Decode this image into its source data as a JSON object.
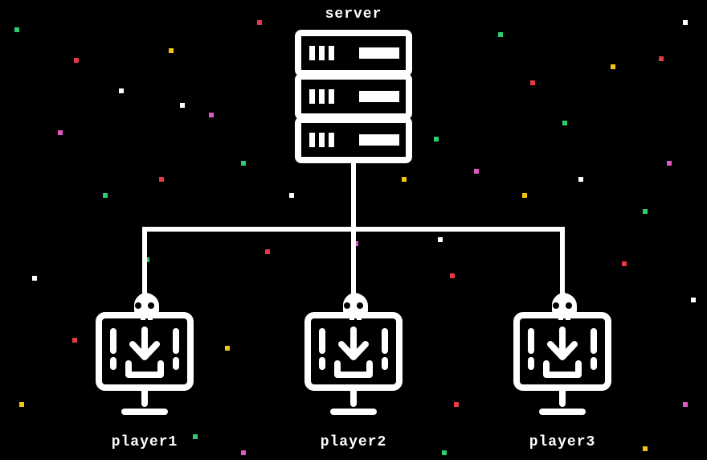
{
  "diagram": {
    "title": "server",
    "server_label": "server",
    "players": [
      "player1",
      "player2",
      "player3"
    ],
    "connections": [
      {
        "from": "server",
        "to": "player1"
      },
      {
        "from": "server",
        "to": "player2"
      },
      {
        "from": "server",
        "to": "player3"
      }
    ],
    "icons": {
      "server": "server-rack-icon",
      "client": "infected-computer-icon"
    }
  },
  "chart_data": {
    "type": "network-diagram",
    "nodes": [
      {
        "id": "server",
        "label": "server",
        "kind": "server"
      },
      {
        "id": "player1",
        "label": "player1",
        "kind": "client"
      },
      {
        "id": "player2",
        "label": "player2",
        "kind": "client"
      },
      {
        "id": "player3",
        "label": "player3",
        "kind": "client"
      }
    ],
    "edges": [
      {
        "from": "server",
        "to": "player1"
      },
      {
        "from": "server",
        "to": "player2"
      },
      {
        "from": "server",
        "to": "player3"
      }
    ]
  },
  "colors": {
    "background": "#000000",
    "foreground": "#ffffff",
    "confetti": [
      "#e63946",
      "#2ecc71",
      "#f1c40f",
      "#e056c4",
      "#ffffff"
    ]
  }
}
